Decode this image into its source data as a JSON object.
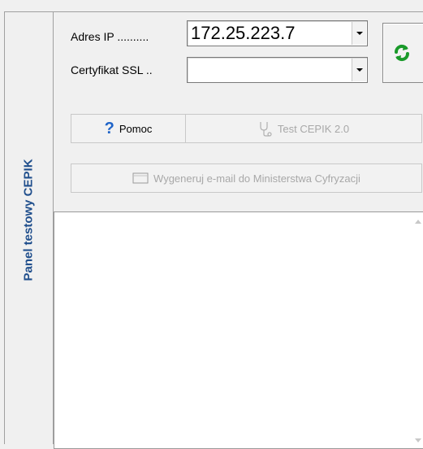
{
  "sidebar": {
    "title": "Panel testowy CEPIK"
  },
  "ip": {
    "label": "Adres IP ..........",
    "value": "172.25.223.7"
  },
  "ssl": {
    "label": "Certyfikat SSL ..",
    "value": ""
  },
  "buttons": {
    "help": "Pomoc",
    "test": "Test CEPIK 2.0",
    "email": "Wygeneruj e-mail do Ministerstwa Cyfryzacji"
  },
  "log": {
    "text": ""
  },
  "icons": {
    "refresh": "refresh-icon",
    "help": "question-mark-icon",
    "test": "stethoscope-icon",
    "email": "envelope-icon"
  },
  "colors": {
    "sidebar_title": "#1f4e8c",
    "refresh": "#1a9a2a",
    "help": "#1e63c8"
  }
}
